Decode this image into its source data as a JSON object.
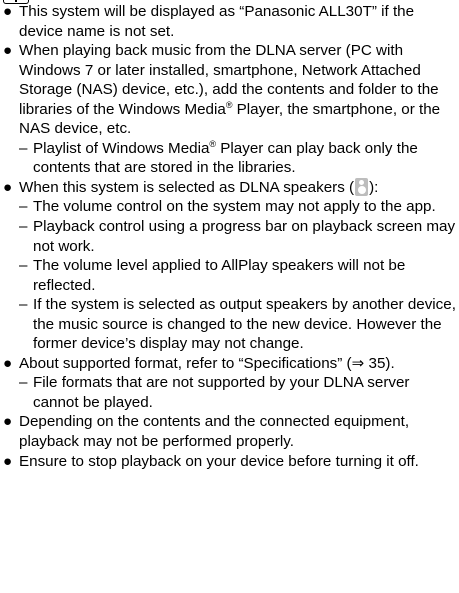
{
  "notes": {
    "bullet_glyph": "●",
    "dash_glyph": "–",
    "item1": "This system will be displayed as “Panasonic ALL30T” if the device name is not set.",
    "item2": "When playing back music from the DLNA server (PC with Windows 7 or later installed, smartphone, Network Attached Storage (NAS) device, etc.), add the contents and folder to the libraries of the Windows Media",
    "item2_reg": "®",
    "item2_tail": " Player, the smartphone, or the NAS device, etc.",
    "item2_sub1_a": "Playlist of Windows Media",
    "item2_sub1_reg": "®",
    "item2_sub1_b": " Player can play back only the contents that are stored in the libraries.",
    "item3_a": "When this system is selected as DLNA speakers (",
    "item3_b": "):",
    "item3_sub1": "The volume control on the system may not apply to the app.",
    "item3_sub2": "Playback control using a progress bar on playback screen may not work.",
    "item3_sub3": "The volume level applied to AllPlay speakers will not be reflected.",
    "item3_sub4": "If the system is selected as output speakers by another device, the music source is changed to the new device. However the former device’s display may not change.",
    "item4": "About supported format, refer to “Specifications” (⇒ 35).",
    "item4_sub1": "File formats that are not supported by your DLNA server cannot be played.",
    "item5": "Depending on the contents and the connected equipment, playback may not be performed properly.",
    "item6": "Ensure to stop playback on your device before turning it off."
  },
  "icons": {
    "note_icon": "book-icon",
    "dlna_speaker_icon": "speaker-icon"
  }
}
